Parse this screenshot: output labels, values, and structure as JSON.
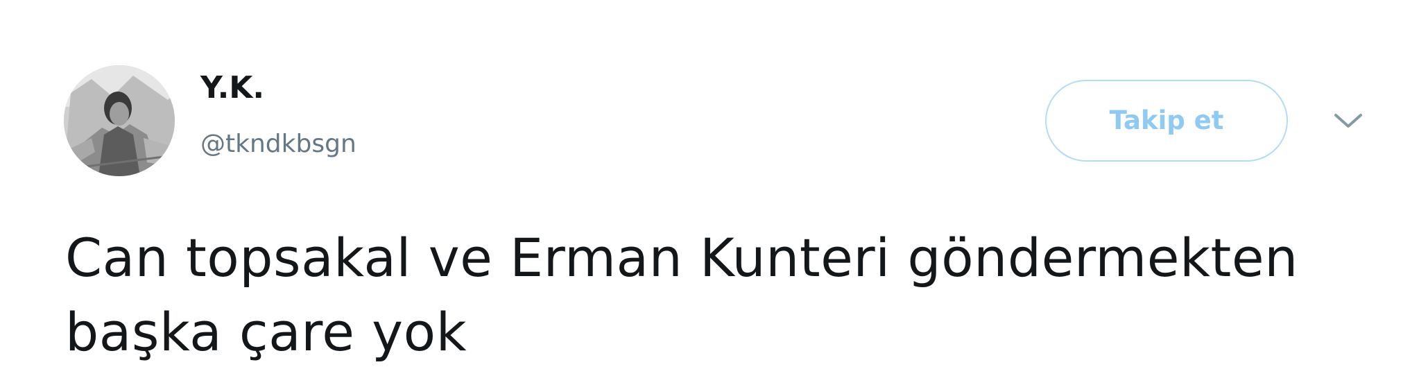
{
  "tweet": {
    "author": {
      "display_name": "Y.K.",
      "handle": "@tkndkbsgn",
      "avatar_icon": "user-avatar-photo"
    },
    "follow_label": "Takip et",
    "menu_icon": "chevron-down-icon",
    "text_lines": [
      "Can topsakal ve Erman Kunteri göndermekten",
      "başka çare yok"
    ]
  },
  "colors": {
    "text": "#14171a",
    "secondary": "#657786",
    "follow_border": "#b2ddf8",
    "follow_text": "#8ecaf3",
    "caret": "#8899a6"
  }
}
